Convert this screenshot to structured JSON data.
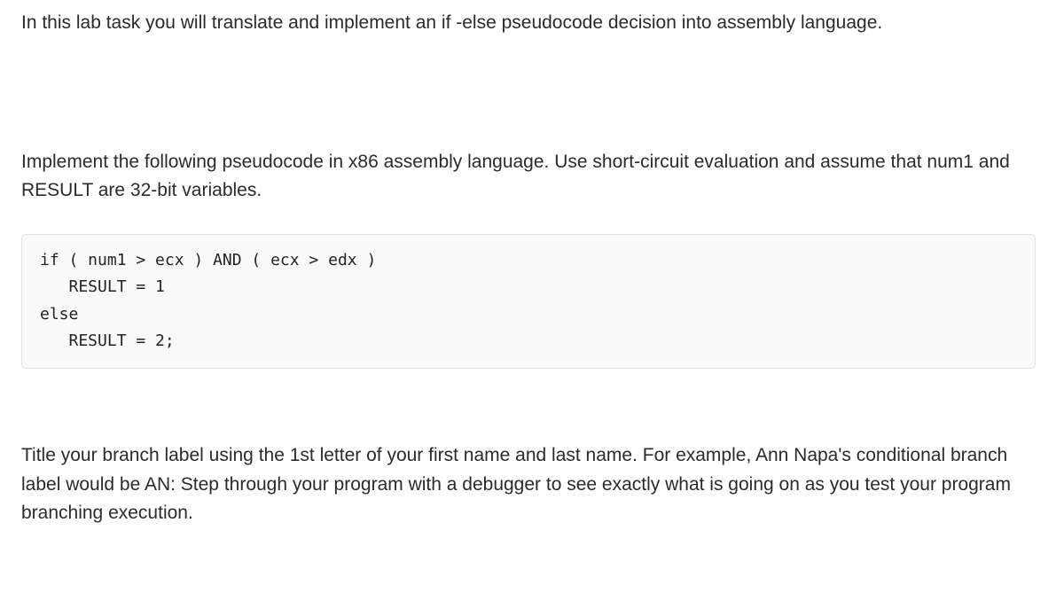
{
  "intro": "In this lab task you will translate and implement an if -else pseudocode decision into assembly language.",
  "instructions": "Implement the following pseudocode in x86 assembly language.  Use short-circuit evaluation and assume that num1 and RESULT are 32-bit variables.",
  "code": "if ( num1 > ecx ) AND ( ecx > edx )\n   RESULT = 1\nelse\n   RESULT = 2;",
  "footer": "Title your branch label using the 1st letter of your first name and last name.  For example, Ann Napa's conditional branch label would be AN:  Step through your program with a debugger to see exactly what is going on as you test your program branching execution."
}
